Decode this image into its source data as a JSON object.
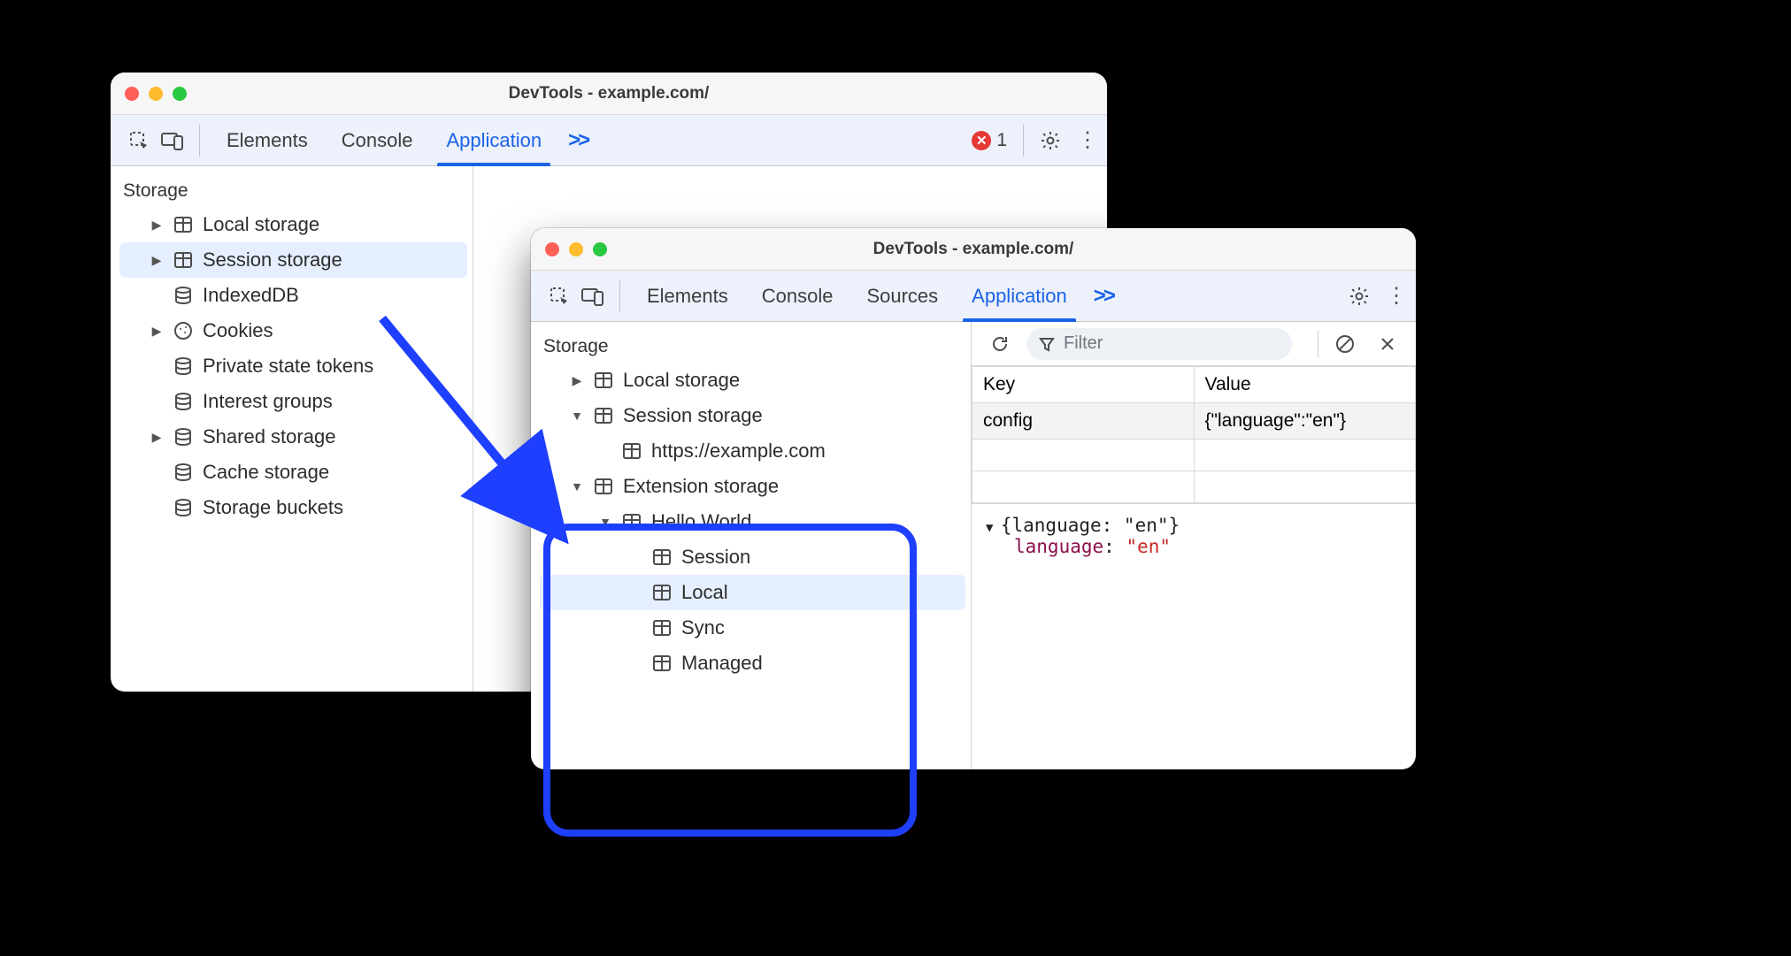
{
  "win_a": {
    "title": "DevTools - example.com/",
    "tabs": {
      "elements": "Elements",
      "console": "Console",
      "application": "Application"
    },
    "errors": "1",
    "storage_label": "Storage",
    "tree": {
      "local_storage": "Local storage",
      "session_storage": "Session storage",
      "indexeddb": "IndexedDB",
      "cookies": "Cookies",
      "private_state_tokens": "Private state tokens",
      "interest_groups": "Interest groups",
      "shared_storage": "Shared storage",
      "cache_storage": "Cache storage",
      "storage_buckets": "Storage buckets"
    }
  },
  "win_b": {
    "title": "DevTools - example.com/",
    "tabs": {
      "elements": "Elements",
      "console": "Console",
      "sources": "Sources",
      "application": "Application"
    },
    "storage_label": "Storage",
    "tree": {
      "local_storage": "Local storage",
      "session_storage": "Session storage",
      "session_child": "https://example.com",
      "extension_storage": "Extension storage",
      "hello_world": "Hello World",
      "session": "Session",
      "local": "Local",
      "sync": "Sync",
      "managed": "Managed"
    },
    "filter_placeholder": "Filter",
    "table": {
      "key_header": "Key",
      "value_header": "Value",
      "row0_key": "config",
      "row0_value": "{\"language\":\"en\"}"
    },
    "viewer": {
      "summary": "{language: \"en\"}",
      "key": "language",
      "sep": ": ",
      "value": "\"en\""
    }
  }
}
